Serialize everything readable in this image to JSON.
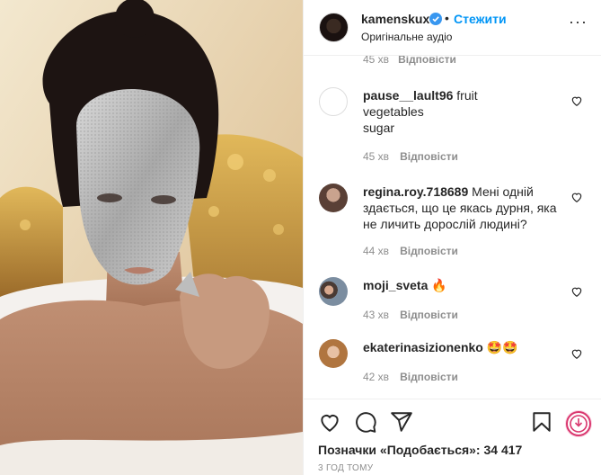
{
  "post": {
    "username": "kamenskux",
    "follow_label": "Стежити",
    "audio_label": "Оригінальне аудіо",
    "more_icon": "more-horizontal-icon",
    "verified_icon": "verified-badge-icon"
  },
  "partial_comment": {
    "time": "45 хв",
    "reply_label": "Відповісти"
  },
  "comments": [
    {
      "username": "pause__lault96",
      "lines": [
        "fruit",
        "vegetables",
        "sugar"
      ],
      "time": "45 хв",
      "reply_label": "Відповісти"
    },
    {
      "username": "regina.roy.718689",
      "text": "Мені одній здається, що це якась дурня, яка не личить дорослій людині?",
      "time": "44 хв",
      "reply_label": "Відповісти"
    },
    {
      "username": "moji_sveta",
      "text": "🔥",
      "time": "43 хв",
      "reply_label": "Відповісти"
    },
    {
      "username": "ekaterinasizionenko",
      "text": "🤩🤩",
      "time": "42 хв",
      "reply_label": "Відповісти"
    }
  ],
  "actions": {
    "like_icon": "heart-icon",
    "comment_icon": "comment-icon",
    "share_icon": "share-icon",
    "save_icon": "bookmark-icon"
  },
  "likes_text": "Позначки «Подобається»: 34 417",
  "timestamp": "3 ГОД ТОМУ",
  "colors": {
    "link_blue": "#0095f6",
    "text_primary": "#262626",
    "text_secondary": "#8e8e8e",
    "border": "#efefef"
  }
}
